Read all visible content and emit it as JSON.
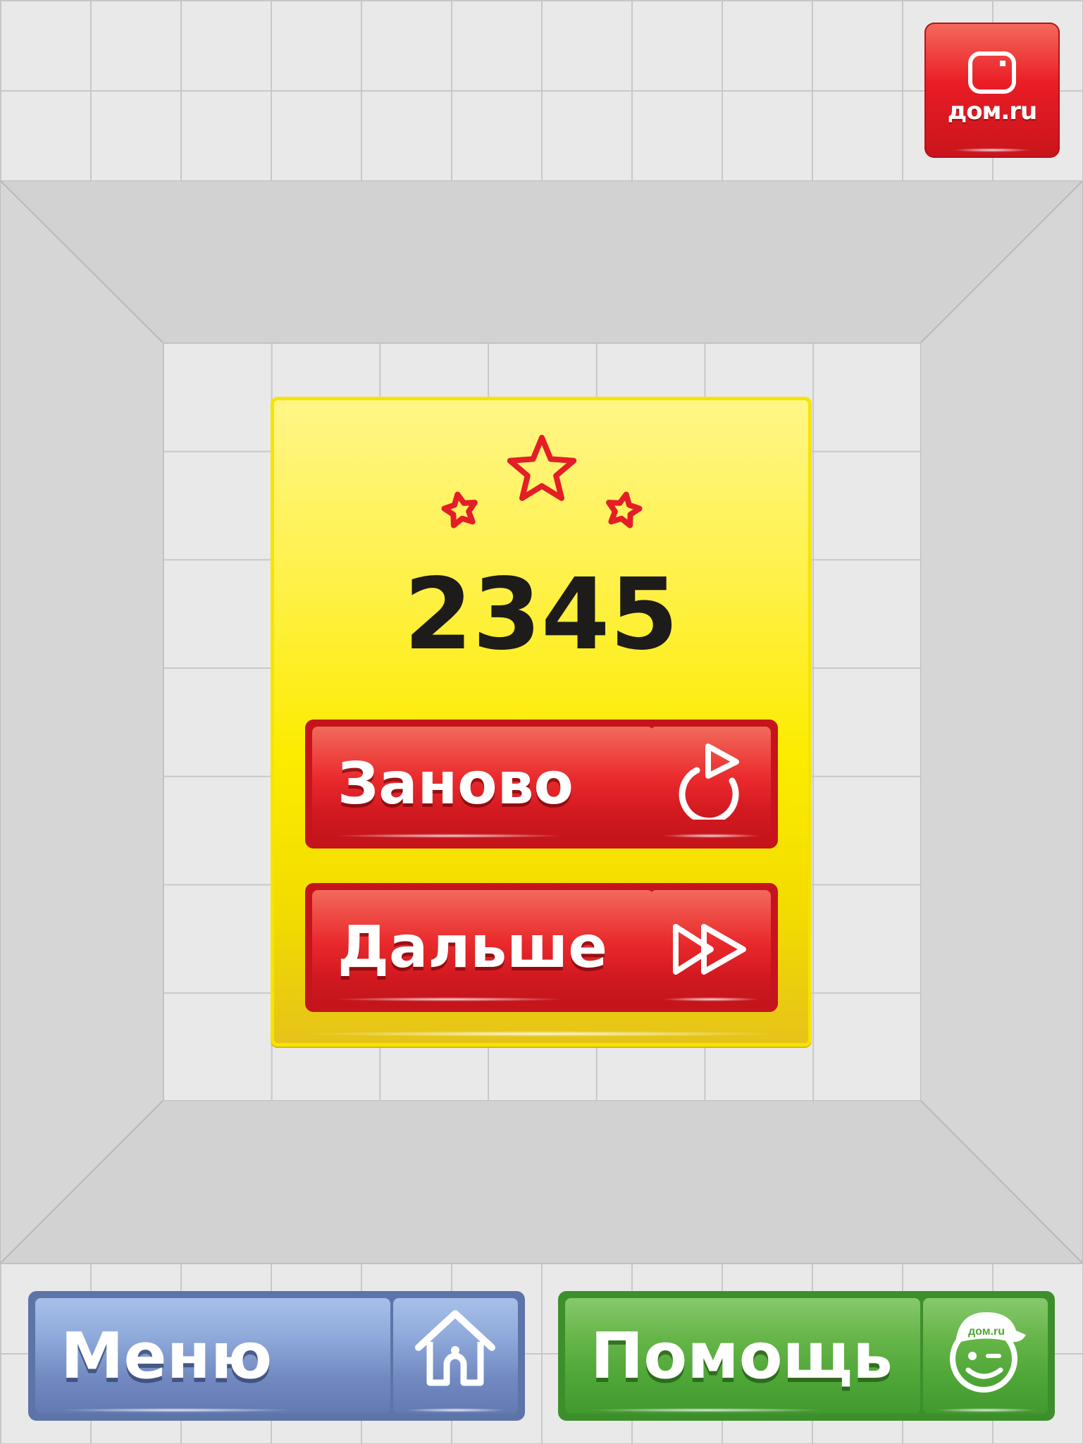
{
  "logo": {
    "text": "дом.ru"
  },
  "result": {
    "score": "2345",
    "stars": 3
  },
  "buttons": {
    "restart_label": "Заново",
    "next_label": "Дальше",
    "menu_label": "Меню",
    "help_label": "Помощь"
  },
  "icons": {
    "restart": "restart-icon",
    "next": "fast-forward-icon",
    "menu": "home-icon",
    "help": "mascot-face-icon",
    "logo": "tv-icon",
    "stars": "star-icon"
  },
  "colors": {
    "panel": "#fcec00",
    "red": "#ea1d25",
    "blue": "#7189c0",
    "green": "#4ea637"
  }
}
